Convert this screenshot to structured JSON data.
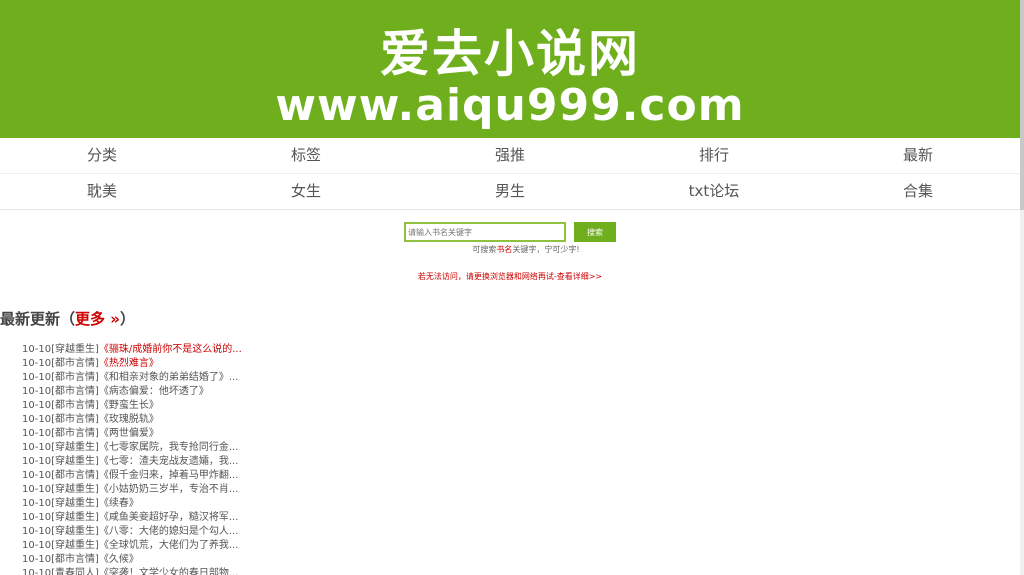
{
  "banner": {
    "title": "爱去小说网",
    "url": "www.aiqu999.com"
  },
  "nav": {
    "row1": [
      "分类",
      "标签",
      "强推",
      "排行",
      "最新"
    ],
    "row2": [
      "耽美",
      "女生",
      "男生",
      "txt论坛",
      "合集"
    ]
  },
  "search": {
    "placeholder": "请输入书名关键字",
    "button": "搜索",
    "hint_prefix": "可搜索",
    "hint_red": "书名",
    "hint_suffix": "关键字，宁可少字!"
  },
  "notice": "若无法访问，请更换浏览器和网络再试-查看详细>>",
  "latest": {
    "heading": "最新更新（",
    "more": "更多 »",
    "close": "）",
    "items": [
      {
        "date": "10-10",
        "cat": "[穿越重生]",
        "title": "《骊珠/成婚前你不是这么说的...",
        "red": true
      },
      {
        "date": "10-10",
        "cat": "[都市言情]",
        "title": "《热烈难言》",
        "red": true
      },
      {
        "date": "10-10",
        "cat": "[都市言情]",
        "title": "《和相亲对象的弟弟结婚了》...",
        "red": false
      },
      {
        "date": "10-10",
        "cat": "[都市言情]",
        "title": "《病态偏爱：他坏透了》",
        "red": false
      },
      {
        "date": "10-10",
        "cat": "[都市言情]",
        "title": "《野蛮生长》",
        "red": false
      },
      {
        "date": "10-10",
        "cat": "[都市言情]",
        "title": "《玫瑰脱轨》",
        "red": false
      },
      {
        "date": "10-10",
        "cat": "[都市言情]",
        "title": "《两世偏爱》",
        "red": false
      },
      {
        "date": "10-10",
        "cat": "[穿越重生]",
        "title": "《七零家属院，我专抢同行金...",
        "red": false
      },
      {
        "date": "10-10",
        "cat": "[穿越重生]",
        "title": "《七零：渣夫宠战友遗孀，我...",
        "red": false
      },
      {
        "date": "10-10",
        "cat": "[都市言情]",
        "title": "《假千金归来，掉着马甲炸翻...",
        "red": false
      },
      {
        "date": "10-10",
        "cat": "[穿越重生]",
        "title": "《小姑奶奶三岁半，专治不肖...",
        "red": false
      },
      {
        "date": "10-10",
        "cat": "[穿越重生]",
        "title": "《续春》",
        "red": false
      },
      {
        "date": "10-10",
        "cat": "[穿越重生]",
        "title": "《咸鱼美妾超好孕，糙汉将军...",
        "red": false
      },
      {
        "date": "10-10",
        "cat": "[穿越重生]",
        "title": "《八零：大佬的媳妇是个勾人...",
        "red": false
      },
      {
        "date": "10-10",
        "cat": "[穿越重生]",
        "title": "《全球饥荒，大佬们为了养我...",
        "red": false
      },
      {
        "date": "10-10",
        "cat": "[都市言情]",
        "title": "《久候》",
        "red": false
      },
      {
        "date": "10-10",
        "cat": "[青春同人]",
        "title": "《突袭！文学少女的春日部物...",
        "red": false
      }
    ]
  }
}
